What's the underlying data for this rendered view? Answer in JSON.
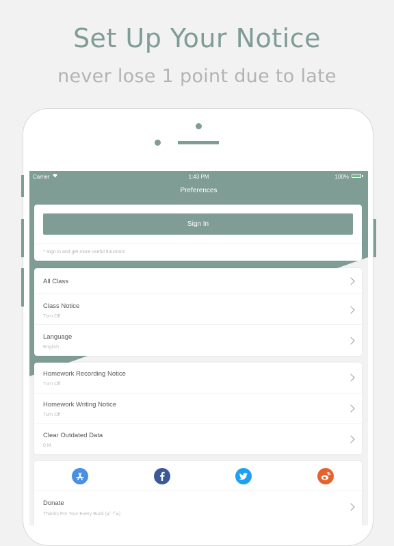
{
  "header": {
    "title": "Set Up Your Notice",
    "subtitle": "never lose 1 point due to late"
  },
  "status_bar": {
    "carrier": "Carrier",
    "time": "1:43 PM",
    "battery": "100%"
  },
  "nav": {
    "title": "Preferences"
  },
  "signin": {
    "button_label": "Sign In",
    "hint": "* Sign in and get more useful functions"
  },
  "group1": [
    {
      "title": "All Class",
      "subtitle": ""
    },
    {
      "title": "Class Notice",
      "subtitle": "Turn Off"
    },
    {
      "title": "Language",
      "subtitle": "English"
    }
  ],
  "group2": [
    {
      "title": "Homework Recording Notice",
      "subtitle": "Turn Off"
    },
    {
      "title": "Homework Writing Notice",
      "subtitle": "Turn Off"
    },
    {
      "title": "Clear Outdated Data",
      "subtitle": "0 M"
    }
  ],
  "social": {
    "icons": [
      "app-store-icon",
      "facebook-icon",
      "twitter-icon",
      "weibo-icon"
    ]
  },
  "donate": {
    "title": "Donate",
    "subtitle": "Thanks For Your Every Buck (๑˘ ³˘๑)"
  },
  "colors": {
    "accent": "#7f9c95",
    "app_store": "#4a90e2",
    "facebook": "#3b5998",
    "twitter": "#1da1f2",
    "weibo": "#e6622c"
  }
}
